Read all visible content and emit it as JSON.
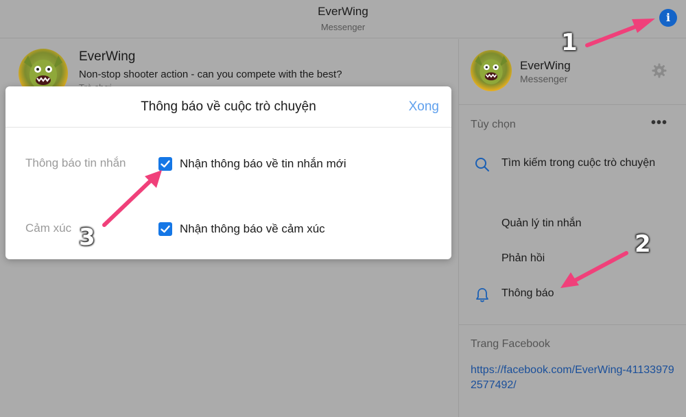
{
  "header": {
    "title": "EverWing",
    "subtitle": "Messenger",
    "info_icon": "info-icon"
  },
  "conversation": {
    "name": "EverWing",
    "description": "Non-stop shooter action - can you compete with the best?",
    "category": "Trò chơi"
  },
  "modal": {
    "title": "Thông báo về cuộc trò chuyện",
    "done_label": "Xong",
    "rows": [
      {
        "label": "Thông báo tin nhắn",
        "option": "Nhận thông báo về tin nhắn mới",
        "checked": true
      },
      {
        "label": "Cảm xúc",
        "option": "Nhận thông báo về cảm xúc",
        "checked": true
      }
    ]
  },
  "sidebar": {
    "name": "EverWing",
    "subtitle": "Messenger",
    "options_label": "Tùy chọn",
    "items": [
      {
        "label": "Tìm kiếm trong cuộc trò chuyện",
        "icon": "search-icon"
      },
      {
        "label": "Quản lý tin nhắn",
        "icon": ""
      },
      {
        "label": "Phản hồi",
        "icon": ""
      },
      {
        "label": "Thông báo",
        "icon": "bell-icon"
      }
    ],
    "facebook_label": "Trang Facebook",
    "facebook_url": "https://facebook.com/EverWing-411339792577492/"
  },
  "annotations": [
    {
      "number": "1",
      "color": "#f0407a"
    },
    {
      "number": "2",
      "color": "#f0407a"
    },
    {
      "number": "3",
      "color": "#f0407a"
    }
  ],
  "colors": {
    "accent": "#1577e6",
    "link": "#1a4f9a",
    "done": "#5fa0ed",
    "arrow": "#f0407a"
  }
}
